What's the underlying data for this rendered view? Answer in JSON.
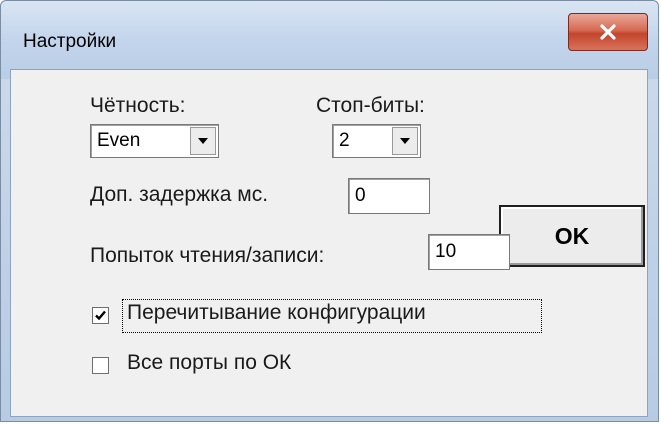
{
  "window": {
    "title": "Настройки",
    "close_icon": "close-icon"
  },
  "parity": {
    "label": "Чётность:",
    "value": "Even"
  },
  "stop_bits": {
    "label": "Стоп-биты:",
    "value": "2"
  },
  "delay": {
    "label": "Доп. задержка мс.",
    "value": "0"
  },
  "attempts": {
    "label": "Попыток чтения/записи:",
    "value": "10"
  },
  "reread_config": {
    "label": "Перечитывание конфигурации",
    "checked": true
  },
  "all_ports_ok": {
    "label": "Все порты по ОК",
    "checked": false
  },
  "ok_button": {
    "label": "OK"
  }
}
